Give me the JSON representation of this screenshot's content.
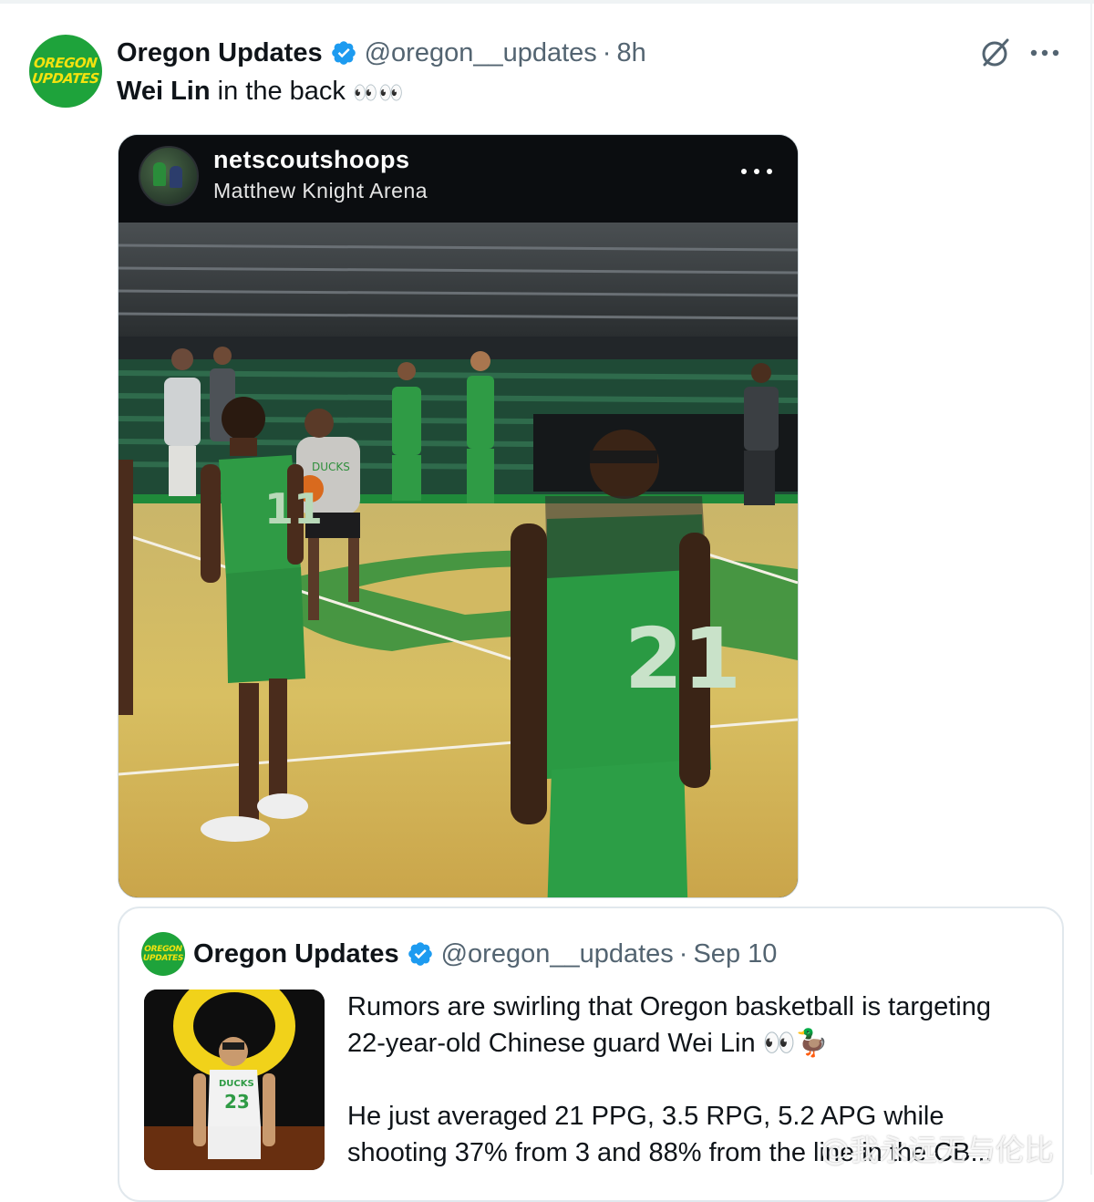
{
  "post": {
    "avatar_text": [
      "OREGON",
      "UPDATES"
    ],
    "author_name": "Oregon Updates",
    "handle": "@oregon__updates",
    "separator": "·",
    "time": "8h",
    "text_bold": "Wei Lin",
    "text_rest": " in the back ",
    "text_emoji": "👀👀",
    "icons": [
      "verified-badge-icon",
      "grok-icon",
      "more-icon"
    ]
  },
  "media": {
    "ig_username": "netscoutshoops",
    "ig_location": "Matthew Knight Arena",
    "ig_more_icon": "more-icon",
    "jersey_numbers": [
      "11",
      "21"
    ],
    "hoodie_text": "DUCKS"
  },
  "quote": {
    "avatar_text": [
      "OREGON",
      "UPDATES"
    ],
    "author_name": "Oregon Updates",
    "handle": "@oregon__updates",
    "separator": "·",
    "date": "Sep 10",
    "line1": "Rumors are swirling that Oregon basketball is targeting",
    "line2": "22-year-old Chinese guard Wei Lin 👀🦆",
    "line3": "He just averaged 21 PPG, 3.5 RPG, 5.2 APG while",
    "line4": "shooting 37% from 3 and 88% from the line in the CB...",
    "thumb_jersey_text": "DUCKS",
    "thumb_jersey_number": "23"
  },
  "watermark": "@我永远无与伦比",
  "colors": {
    "brand_green": "#1ea33b",
    "brand_yellow": "#f3e20f",
    "verified_blue": "#1d9bf0",
    "muted_text": "#536471"
  }
}
